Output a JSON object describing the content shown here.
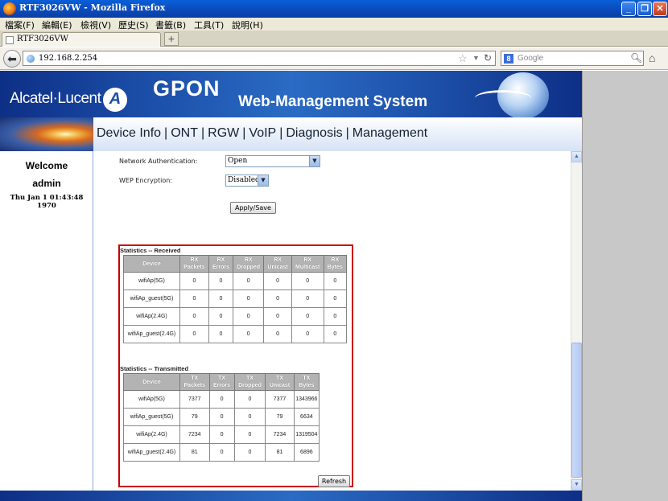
{
  "window": {
    "title": "RTF3026VW - Mozilla Firefox"
  },
  "menubar": [
    "檔案(F)",
    "編輯(E)",
    "檢視(V)",
    "歷史(S)",
    "書籤(B)",
    "工具(T)",
    "說明(H)"
  ],
  "tab": {
    "label": "RTF3026VW",
    "newtab": "+"
  },
  "navbar": {
    "url": "192.168.2.254",
    "search_placeholder": "Google",
    "search_engine": "8"
  },
  "banner": {
    "brand": "Alcatel·Lucent",
    "title": "GPON",
    "subtitle": "Web-Management System"
  },
  "sidebar": {
    "welcome": "Welcome",
    "user": "admin",
    "datetime": "Thu Jan 1 01:43:48 1970"
  },
  "nav": {
    "items": [
      "Device Info",
      "ONT",
      "RGW",
      "VoIP",
      "Diagnosis",
      "Management"
    ],
    "separator": "|"
  },
  "form": {
    "auth_label": "Network Authentication:",
    "auth_value": "Open",
    "wep_label": "WEP Encryption:",
    "wep_value": "Disabled",
    "apply_label": "Apply/Save"
  },
  "received": {
    "title": "Statistics -- Received",
    "headers": [
      "Device",
      "RX Packets",
      "RX Errors",
      "RX Dropped",
      "RX Unicast",
      "RX Multicast",
      "RX Bytes"
    ],
    "rows": [
      [
        "wifiAp(5G)",
        "0",
        "0",
        "0",
        "0",
        "0",
        "0"
      ],
      [
        "wifiAp_guest(5G)",
        "0",
        "0",
        "0",
        "0",
        "0",
        "0"
      ],
      [
        "wifiAp(2.4G)",
        "0",
        "0",
        "0",
        "0",
        "0",
        "0"
      ],
      [
        "wifiAp_guest(2.4G)",
        "0",
        "0",
        "0",
        "0",
        "0",
        "0"
      ]
    ]
  },
  "transmitted": {
    "title": "Statistics -- Transmitted",
    "headers": [
      "Device",
      "TX Packets",
      "TX Errors",
      "TX Dropped",
      "TX Unicast",
      "TX Bytes"
    ],
    "rows": [
      [
        "wifiAp(5G)",
        "7377",
        "0",
        "0",
        "7377",
        "1343966"
      ],
      [
        "wifiAp_guest(5G)",
        "79",
        "0",
        "0",
        "79",
        "6634"
      ],
      [
        "wifiAp(2.4G)",
        "7234",
        "0",
        "0",
        "7234",
        "1319504"
      ],
      [
        "wifiAp_guest(2.4G)",
        "81",
        "0",
        "0",
        "81",
        "6896"
      ]
    ]
  },
  "refresh_label": "Refresh",
  "colors": {
    "highlight_border": "#c80000",
    "header_bg": "#0e2f86",
    "table_header": "#b3b3b3"
  }
}
